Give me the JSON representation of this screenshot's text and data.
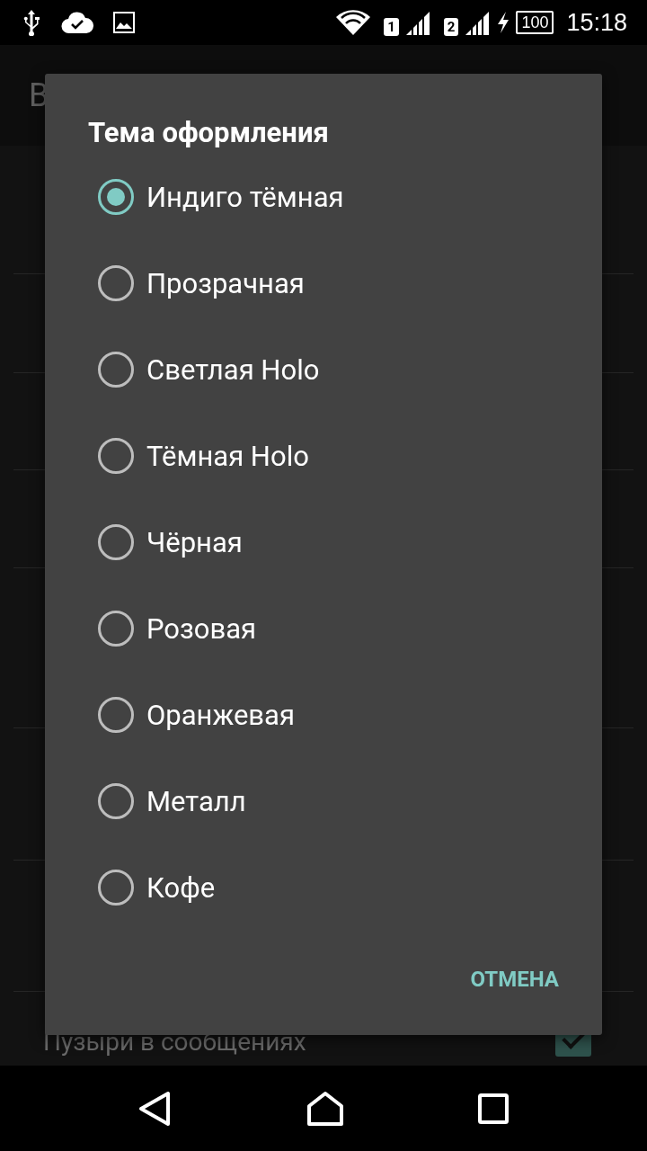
{
  "status_bar": {
    "sim_1": "1",
    "sim_2": "2",
    "battery": "100",
    "time": "15:18"
  },
  "app_bar": {
    "title": "В"
  },
  "settings": {
    "last_item": {
      "label": "Пузыри в сообщениях",
      "checked": true
    }
  },
  "dialog": {
    "title": "Тема оформления",
    "options": [
      {
        "label": "Индиго тёмная",
        "selected": true
      },
      {
        "label": "Прозрачная",
        "selected": false
      },
      {
        "label": "Светлая Holo",
        "selected": false
      },
      {
        "label": "Тёмная Holo",
        "selected": false
      },
      {
        "label": "Чёрная",
        "selected": false
      },
      {
        "label": "Розовая",
        "selected": false
      },
      {
        "label": "Оранжевая",
        "selected": false
      },
      {
        "label": "Металл",
        "selected": false
      },
      {
        "label": "Кофе",
        "selected": false
      }
    ],
    "cancel": "ОТМЕНА"
  }
}
